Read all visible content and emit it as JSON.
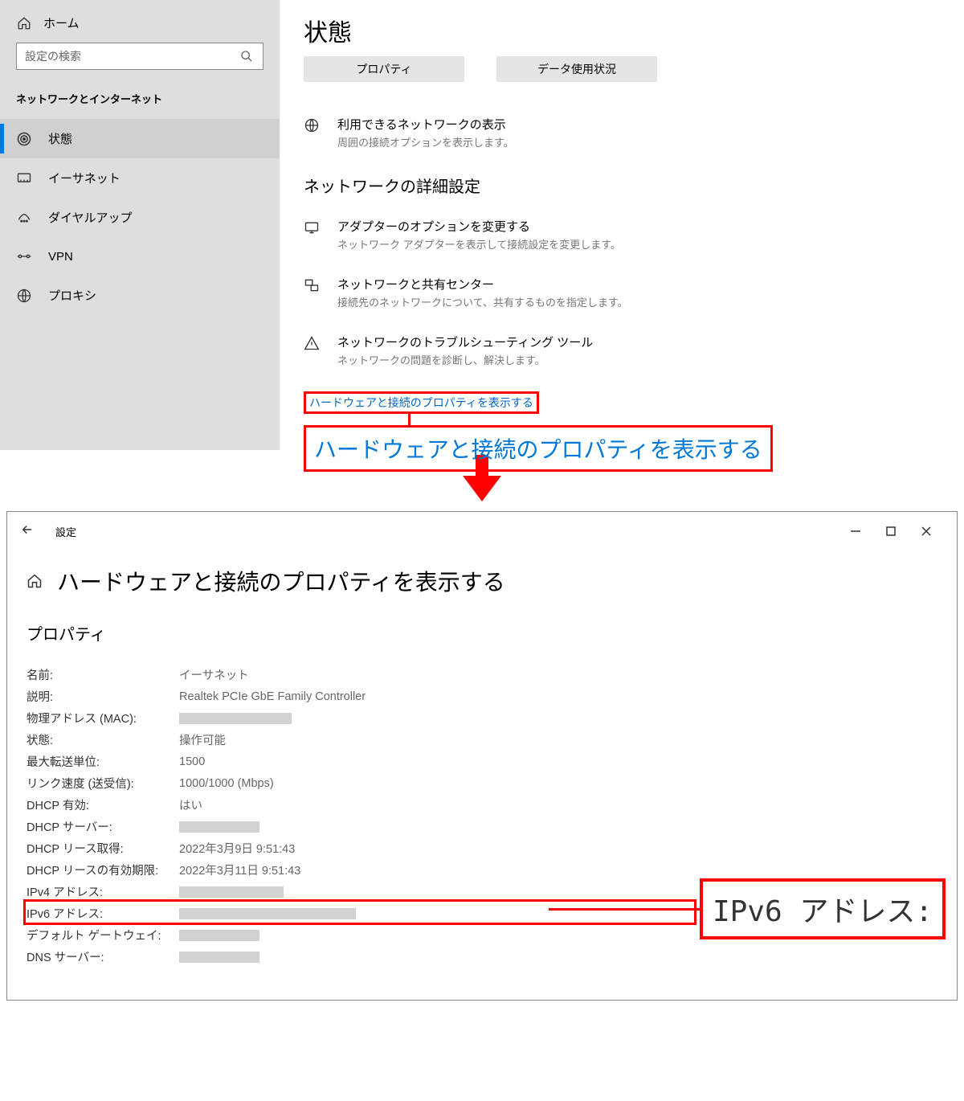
{
  "sidebar": {
    "home": "ホーム",
    "search_placeholder": "設定の検索",
    "category": "ネットワークとインターネット",
    "items": [
      {
        "label": "状態"
      },
      {
        "label": "イーサネット"
      },
      {
        "label": "ダイヤルアップ"
      },
      {
        "label": "VPN"
      },
      {
        "label": "プロキシ"
      }
    ]
  },
  "content": {
    "title": "状態",
    "btn_properties": "プロパティ",
    "btn_data_usage": "データ使用状況",
    "info": [
      {
        "title": "利用できるネットワークの表示",
        "desc": "周囲の接続オプションを表示します。"
      }
    ],
    "section_heading": "ネットワークの詳細設定",
    "advanced": [
      {
        "title": "アダプターのオプションを変更する",
        "desc": "ネットワーク アダプターを表示して接続設定を変更します。"
      },
      {
        "title": "ネットワークと共有センター",
        "desc": "接続先のネットワークについて、共有するものを指定します。"
      },
      {
        "title": "ネットワークのトラブルシューティング ツール",
        "desc": "ネットワークの問題を診断し、解決します。"
      }
    ],
    "link": "ハードウェアと接続のプロパティを表示する",
    "link_big": "ハードウェアと接続のプロパティを表示する"
  },
  "bottom": {
    "appname": "設定",
    "page_title": "ハードウェアと接続のプロパティを表示する",
    "props_title": "プロパティ",
    "rows": [
      {
        "label": "名前:",
        "value": "イーサネット"
      },
      {
        "label": "説明:",
        "value": "Realtek PCIe GbE Family Controller"
      },
      {
        "label": "物理アドレス (MAC):",
        "value": "",
        "redact": 140
      },
      {
        "label": "状態:",
        "value": "操作可能"
      },
      {
        "label": "最大転送単位:",
        "value": "1500"
      },
      {
        "label": "リンク速度 (送受信):",
        "value": "1000/1000 (Mbps)"
      },
      {
        "label": "DHCP 有効:",
        "value": "はい"
      },
      {
        "label": "DHCP サーバー:",
        "value": "",
        "redact": 100
      },
      {
        "label": "DHCP リース取得:",
        "value": "2022年3月9日 9:51:43"
      },
      {
        "label": "DHCP リースの有効期限:",
        "value": "2022年3月11日 9:51:43"
      },
      {
        "label": "IPv4 アドレス:",
        "value": "",
        "redact": 130
      },
      {
        "label": "IPv6 アドレス:",
        "value": "",
        "redact": 220
      },
      {
        "label": "デフォルト ゲートウェイ:",
        "value": "",
        "redact": 100
      },
      {
        "label": "DNS サーバー:",
        "value": "",
        "redact": 100
      }
    ],
    "ipv6_callout": "IPv6 アドレス:"
  }
}
